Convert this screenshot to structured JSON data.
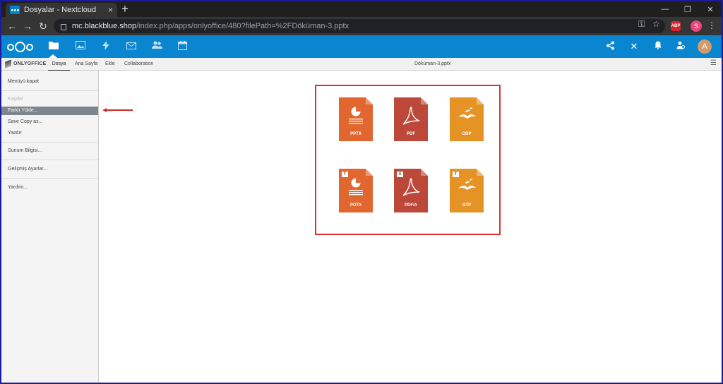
{
  "browser": {
    "tab_title": "Dosyalar - Nextcloud",
    "tab_close": "×",
    "new_tab": "+",
    "window_controls": [
      "—",
      "❐",
      "✕"
    ],
    "url_domain": "mc.blackblue.shop",
    "url_path": "/index.php/apps/onlyoffice/480?filePath=%2FDöküman-3.pptx",
    "extension_badge": "ABP",
    "profile_initial": "S",
    "nav_icons": [
      "back-arrow-icon",
      "forward-arrow-icon",
      "reload-icon"
    ]
  },
  "nextcloud": {
    "apps": [
      "folder-icon",
      "image-icon",
      "activity-icon",
      "mail-icon",
      "contacts-icon",
      "calendar-icon"
    ],
    "active_app": "folder-icon",
    "right_icons": [
      "share-icon",
      "close-icon",
      "bell-icon",
      "user-status-icon"
    ],
    "avatar_initial": "A",
    "accent_color": "#0a86d0"
  },
  "onlyoffice": {
    "brand": "ONLYOFFICE",
    "tabs": [
      "Dosya",
      "Ana Sayfa",
      "Ekle",
      "Collaboration"
    ],
    "active_tab": "Dosya",
    "document_title": "Döküman-3.pptx"
  },
  "file_menu": {
    "items": [
      {
        "label": "Menüyü kapat",
        "state": "normal"
      },
      {
        "label": "Kaydet",
        "state": "disabled"
      },
      {
        "label": "Farklı Yükle...",
        "state": "selected"
      },
      {
        "label": "Save Copy as...",
        "state": "normal"
      },
      {
        "label": "Yazdır",
        "state": "normal"
      },
      {
        "label": "Sunum Bilgisi...",
        "state": "normal"
      },
      {
        "label": "Gelişmiş Ayarlar...",
        "state": "normal"
      },
      {
        "label": "Yardım...",
        "state": "normal"
      }
    ]
  },
  "formats": [
    {
      "label": "PPTX",
      "color": "#e1662f",
      "glyph": "presentation",
      "badge": ""
    },
    {
      "label": "PDF",
      "color": "#bb4839",
      "glyph": "pdf",
      "badge": ""
    },
    {
      "label": "ODP",
      "color": "#e59325",
      "glyph": "gull",
      "badge": ""
    },
    {
      "label": "POTX",
      "color": "#e1662f",
      "glyph": "presentation",
      "badge": "T"
    },
    {
      "label": "PDF/A",
      "color": "#bb4839",
      "glyph": "pdf",
      "badge": "A"
    },
    {
      "label": "OTP",
      "color": "#e59325",
      "glyph": "gull",
      "badge": "T"
    }
  ],
  "annotation_color": "#e03131"
}
